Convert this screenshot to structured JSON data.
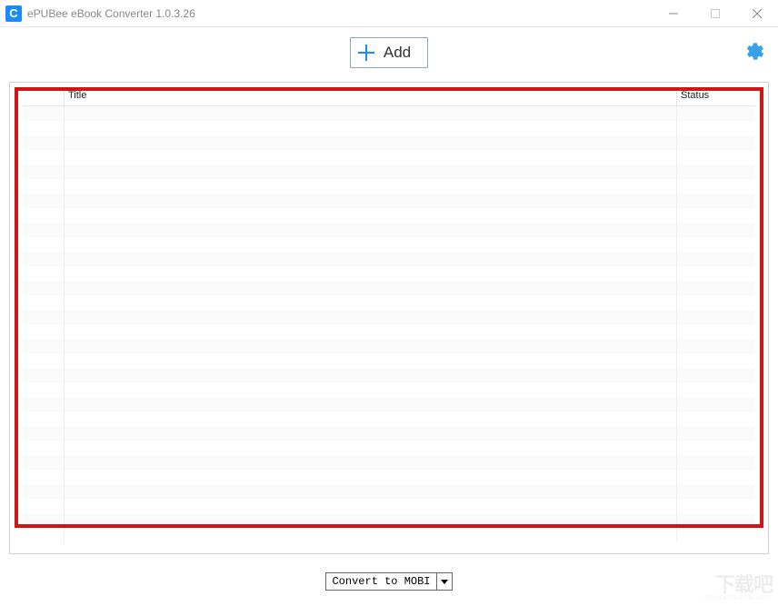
{
  "window": {
    "title": "ePUBee eBook Converter 1.0.3.26",
    "app_icon_letter": "C"
  },
  "toolbar": {
    "add_label": "Add"
  },
  "table": {
    "columns": {
      "checkbox": "",
      "title": "Title",
      "status": "Status"
    },
    "rows": []
  },
  "footer": {
    "convert_label": "Convert to MOBI"
  },
  "watermark": {
    "main": "下载吧",
    "sub": "www.xiazaiba.com"
  }
}
